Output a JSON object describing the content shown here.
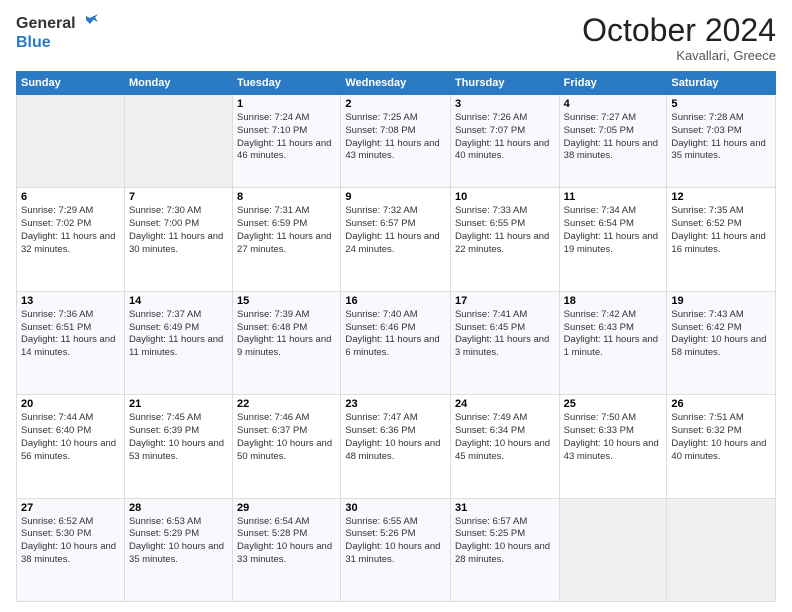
{
  "header": {
    "logo_general": "General",
    "logo_blue": "Blue",
    "month": "October 2024",
    "location": "Kavallari, Greece"
  },
  "days_of_week": [
    "Sunday",
    "Monday",
    "Tuesday",
    "Wednesday",
    "Thursday",
    "Friday",
    "Saturday"
  ],
  "weeks": [
    [
      {
        "num": "",
        "info": ""
      },
      {
        "num": "",
        "info": ""
      },
      {
        "num": "1",
        "info": "Sunrise: 7:24 AM\nSunset: 7:10 PM\nDaylight: 11 hours and 46 minutes."
      },
      {
        "num": "2",
        "info": "Sunrise: 7:25 AM\nSunset: 7:08 PM\nDaylight: 11 hours and 43 minutes."
      },
      {
        "num": "3",
        "info": "Sunrise: 7:26 AM\nSunset: 7:07 PM\nDaylight: 11 hours and 40 minutes."
      },
      {
        "num": "4",
        "info": "Sunrise: 7:27 AM\nSunset: 7:05 PM\nDaylight: 11 hours and 38 minutes."
      },
      {
        "num": "5",
        "info": "Sunrise: 7:28 AM\nSunset: 7:03 PM\nDaylight: 11 hours and 35 minutes."
      }
    ],
    [
      {
        "num": "6",
        "info": "Sunrise: 7:29 AM\nSunset: 7:02 PM\nDaylight: 11 hours and 32 minutes."
      },
      {
        "num": "7",
        "info": "Sunrise: 7:30 AM\nSunset: 7:00 PM\nDaylight: 11 hours and 30 minutes."
      },
      {
        "num": "8",
        "info": "Sunrise: 7:31 AM\nSunset: 6:59 PM\nDaylight: 11 hours and 27 minutes."
      },
      {
        "num": "9",
        "info": "Sunrise: 7:32 AM\nSunset: 6:57 PM\nDaylight: 11 hours and 24 minutes."
      },
      {
        "num": "10",
        "info": "Sunrise: 7:33 AM\nSunset: 6:55 PM\nDaylight: 11 hours and 22 minutes."
      },
      {
        "num": "11",
        "info": "Sunrise: 7:34 AM\nSunset: 6:54 PM\nDaylight: 11 hours and 19 minutes."
      },
      {
        "num": "12",
        "info": "Sunrise: 7:35 AM\nSunset: 6:52 PM\nDaylight: 11 hours and 16 minutes."
      }
    ],
    [
      {
        "num": "13",
        "info": "Sunrise: 7:36 AM\nSunset: 6:51 PM\nDaylight: 11 hours and 14 minutes."
      },
      {
        "num": "14",
        "info": "Sunrise: 7:37 AM\nSunset: 6:49 PM\nDaylight: 11 hours and 11 minutes."
      },
      {
        "num": "15",
        "info": "Sunrise: 7:39 AM\nSunset: 6:48 PM\nDaylight: 11 hours and 9 minutes."
      },
      {
        "num": "16",
        "info": "Sunrise: 7:40 AM\nSunset: 6:46 PM\nDaylight: 11 hours and 6 minutes."
      },
      {
        "num": "17",
        "info": "Sunrise: 7:41 AM\nSunset: 6:45 PM\nDaylight: 11 hours and 3 minutes."
      },
      {
        "num": "18",
        "info": "Sunrise: 7:42 AM\nSunset: 6:43 PM\nDaylight: 11 hours and 1 minute."
      },
      {
        "num": "19",
        "info": "Sunrise: 7:43 AM\nSunset: 6:42 PM\nDaylight: 10 hours and 58 minutes."
      }
    ],
    [
      {
        "num": "20",
        "info": "Sunrise: 7:44 AM\nSunset: 6:40 PM\nDaylight: 10 hours and 56 minutes."
      },
      {
        "num": "21",
        "info": "Sunrise: 7:45 AM\nSunset: 6:39 PM\nDaylight: 10 hours and 53 minutes."
      },
      {
        "num": "22",
        "info": "Sunrise: 7:46 AM\nSunset: 6:37 PM\nDaylight: 10 hours and 50 minutes."
      },
      {
        "num": "23",
        "info": "Sunrise: 7:47 AM\nSunset: 6:36 PM\nDaylight: 10 hours and 48 minutes."
      },
      {
        "num": "24",
        "info": "Sunrise: 7:49 AM\nSunset: 6:34 PM\nDaylight: 10 hours and 45 minutes."
      },
      {
        "num": "25",
        "info": "Sunrise: 7:50 AM\nSunset: 6:33 PM\nDaylight: 10 hours and 43 minutes."
      },
      {
        "num": "26",
        "info": "Sunrise: 7:51 AM\nSunset: 6:32 PM\nDaylight: 10 hours and 40 minutes."
      }
    ],
    [
      {
        "num": "27",
        "info": "Sunrise: 6:52 AM\nSunset: 5:30 PM\nDaylight: 10 hours and 38 minutes."
      },
      {
        "num": "28",
        "info": "Sunrise: 6:53 AM\nSunset: 5:29 PM\nDaylight: 10 hours and 35 minutes."
      },
      {
        "num": "29",
        "info": "Sunrise: 6:54 AM\nSunset: 5:28 PM\nDaylight: 10 hours and 33 minutes."
      },
      {
        "num": "30",
        "info": "Sunrise: 6:55 AM\nSunset: 5:26 PM\nDaylight: 10 hours and 31 minutes."
      },
      {
        "num": "31",
        "info": "Sunrise: 6:57 AM\nSunset: 5:25 PM\nDaylight: 10 hours and 28 minutes."
      },
      {
        "num": "",
        "info": ""
      },
      {
        "num": "",
        "info": ""
      }
    ]
  ]
}
